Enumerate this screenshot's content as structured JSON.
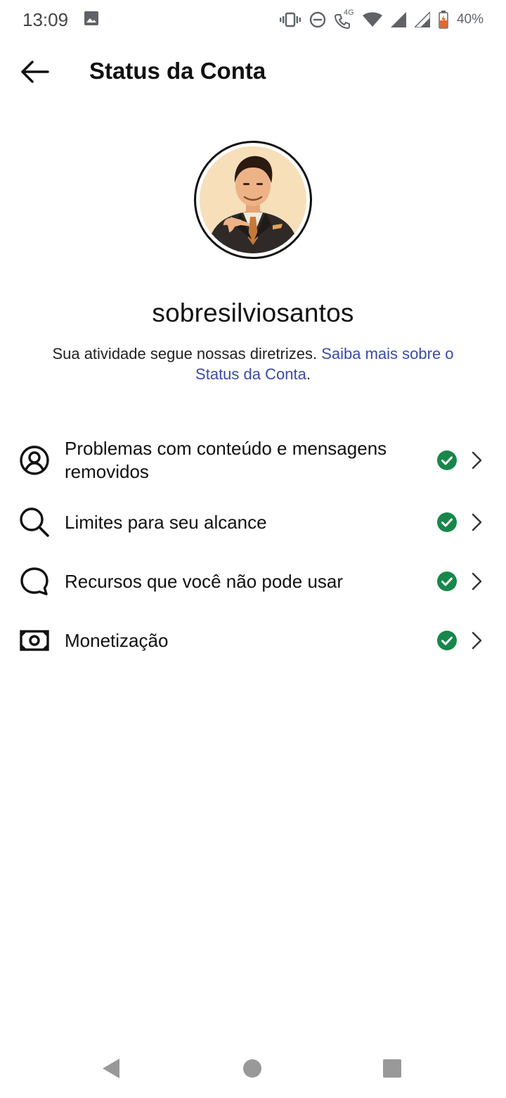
{
  "status_bar": {
    "time": "13:09",
    "battery": "40%",
    "network": "4G",
    "icons": [
      "image-icon",
      "vibrate-icon",
      "dnd-icon",
      "volte-call-icon",
      "wifi-icon",
      "signal-icon",
      "signal-icon",
      "battery-icon"
    ]
  },
  "header": {
    "title": "Status da Conta",
    "back_icon": "arrow-left-icon"
  },
  "profile": {
    "username": "sobresilviosantos",
    "description": "Sua atividade segue nossas diretrizes. ",
    "link_text": "Saiba mais sobre o Status da Conta",
    "trailing": "."
  },
  "items": [
    {
      "label": "Problemas com conteúdo e mensagens removidos",
      "icon": "user-circle-icon",
      "status": "ok"
    },
    {
      "label": "Limites para seu alcance",
      "icon": "search-icon",
      "status": "ok"
    },
    {
      "label": "Recursos que você não pode usar",
      "icon": "chat-bubble-icon",
      "status": "ok"
    },
    {
      "label": "Monetização",
      "icon": "money-icon",
      "status": "ok"
    }
  ],
  "colors": {
    "check_green": "#17874a",
    "link_blue": "#3a4ba8"
  }
}
